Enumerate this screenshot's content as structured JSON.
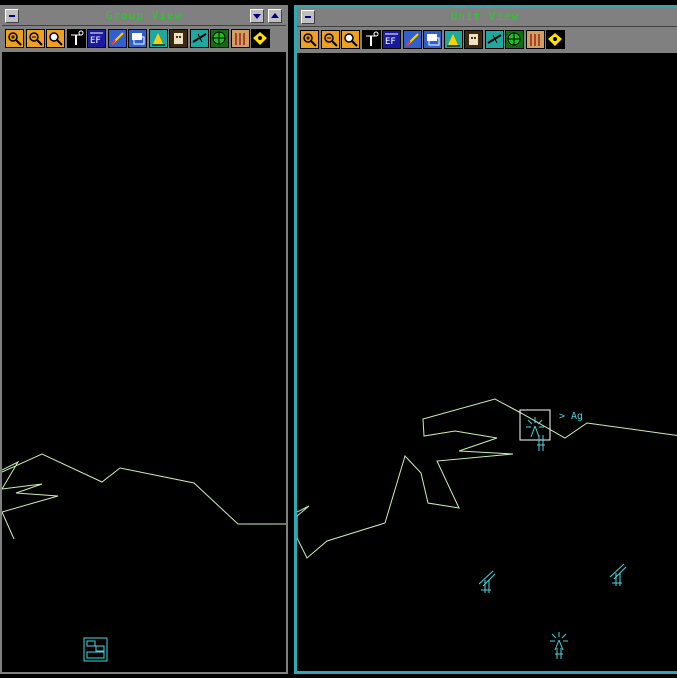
{
  "colors": {
    "title_text": "#1fd21f",
    "terrain": "#c8f0b4",
    "unit": "#4ad7e0",
    "active_border": "#2ea9b3"
  },
  "group_view": {
    "title": "Group View",
    "toolbar": [
      "zoom-in-icon",
      "zoom-out-icon",
      "zoom-magnify-icon",
      "antenna-icon",
      "ef-icon",
      "edit-icon",
      "map-layers-icon",
      "terrain-icon",
      "face-icon",
      "aircraft-icon",
      "radar-target-icon",
      "columns-icon",
      "waypoint-icon"
    ]
  },
  "unit_view": {
    "title": "Unit View",
    "unit_label": "> Ag",
    "toolbar": [
      "zoom-in-icon",
      "zoom-out-icon",
      "zoom-magnify-icon",
      "antenna-icon",
      "ef-icon",
      "edit-icon",
      "map-layers-icon",
      "terrain-icon",
      "face-icon",
      "aircraft-icon",
      "radar-target-icon",
      "columns-icon",
      "waypoint-icon"
    ]
  }
}
